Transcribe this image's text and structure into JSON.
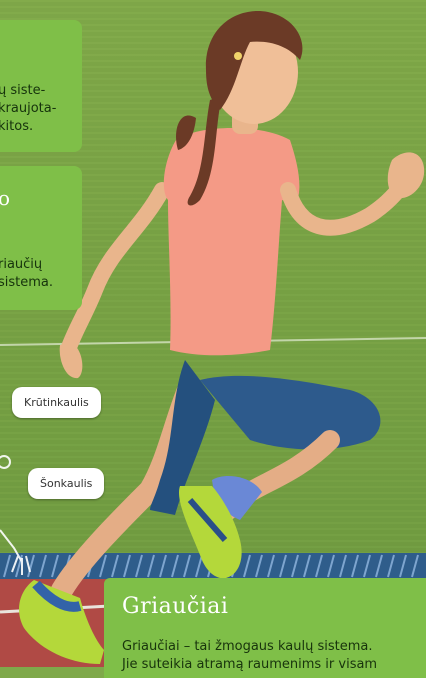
{
  "cards": {
    "top": {
      "lines": [
        "ų siste-",
        "kraujota-",
        "kitos."
      ]
    },
    "middle": {
      "heading": "o",
      "lines": [
        "riaučių",
        "sistema."
      ]
    }
  },
  "labels": {
    "chest": "Krūtinkaulis",
    "rib": "Šonkaulis"
  },
  "bottom": {
    "title": "Griaučiai",
    "text_line1": "Griaučiai – tai žmogaus kaulų sistema.",
    "text_line2": "Jie suteikia atramą raumenims ir visam"
  },
  "colors": {
    "panel": "#7fbf48",
    "grass": "#7fa94a",
    "shirt": "#f49a86",
    "leggings": "#2d5a8c",
    "shoe": "#b4d83a"
  }
}
